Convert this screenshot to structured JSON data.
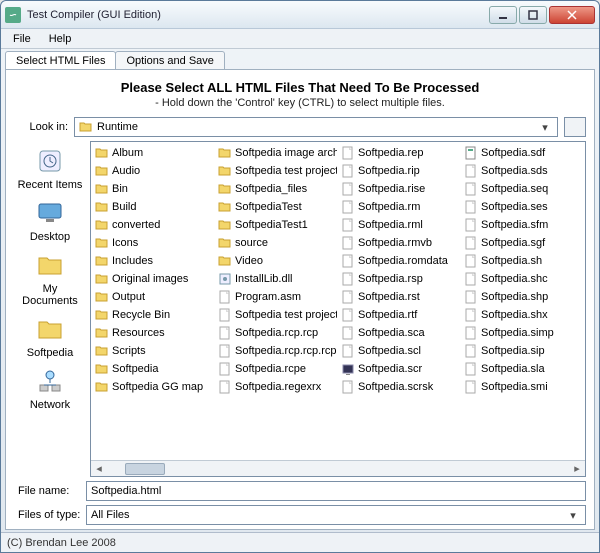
{
  "window": {
    "title": "Test Compiler (GUI Edition)"
  },
  "menu": {
    "file": "File",
    "help": "Help"
  },
  "tabs": {
    "select": "Select HTML Files",
    "options": "Options and Save"
  },
  "panel": {
    "heading": "Please Select ALL HTML Files That Need To Be Processed",
    "subheading": "- Hold down the 'Control' key (CTRL) to select multiple files.",
    "lookin_label": "Look in:",
    "lookin_value": "Runtime",
    "filename_label": "File name:",
    "filename_value": "Softpedia.html",
    "filetype_label": "Files of type:",
    "filetype_value": "All Files"
  },
  "places": [
    {
      "id": "recent",
      "label": "Recent Items"
    },
    {
      "id": "desktop",
      "label": "Desktop"
    },
    {
      "id": "mydocs",
      "label": "My Documents"
    },
    {
      "id": "softpedia",
      "label": "Softpedia"
    },
    {
      "id": "network",
      "label": "Network"
    }
  ],
  "files": [
    {
      "n": "Album",
      "t": "folder"
    },
    {
      "n": "Audio",
      "t": "folder"
    },
    {
      "n": "Bin",
      "t": "folder"
    },
    {
      "n": "Build",
      "t": "folder"
    },
    {
      "n": "converted",
      "t": "folder"
    },
    {
      "n": "Icons",
      "t": "folder"
    },
    {
      "n": "Includes",
      "t": "folder"
    },
    {
      "n": "Original images",
      "t": "folder"
    },
    {
      "n": "Output",
      "t": "folder"
    },
    {
      "n": "Recycle Bin",
      "t": "folder"
    },
    {
      "n": "Resources",
      "t": "folder"
    },
    {
      "n": "Scripts",
      "t": "folder"
    },
    {
      "n": "Softpedia",
      "t": "folder"
    },
    {
      "n": "Softpedia GG map",
      "t": "folder"
    },
    {
      "n": "Softpedia image archive",
      "t": "folder"
    },
    {
      "n": "Softpedia test project",
      "t": "folder"
    },
    {
      "n": "Softpedia_files",
      "t": "folder"
    },
    {
      "n": "SoftpediaTest",
      "t": "folder"
    },
    {
      "n": "SoftpediaTest1",
      "t": "folder"
    },
    {
      "n": "source",
      "t": "folder"
    },
    {
      "n": "Video",
      "t": "folder"
    },
    {
      "n": "InstallLib.dll",
      "t": "dll"
    },
    {
      "n": "Program.asm",
      "t": "file"
    },
    {
      "n": "Softpedia test project.lnp",
      "t": "file"
    },
    {
      "n": "Softpedia.rcp.rcp",
      "t": "file"
    },
    {
      "n": "Softpedia.rcp.rcp.rcp",
      "t": "file"
    },
    {
      "n": "Softpedia.rcpe",
      "t": "file"
    },
    {
      "n": "Softpedia.regexrx",
      "t": "file"
    },
    {
      "n": "Softpedia.rep",
      "t": "file"
    },
    {
      "n": "Softpedia.rip",
      "t": "file"
    },
    {
      "n": "Softpedia.rise",
      "t": "file"
    },
    {
      "n": "Softpedia.rm",
      "t": "file"
    },
    {
      "n": "Softpedia.rml",
      "t": "file"
    },
    {
      "n": "Softpedia.rmvb",
      "t": "file"
    },
    {
      "n": "Softpedia.romdata",
      "t": "file"
    },
    {
      "n": "Softpedia.rsp",
      "t": "file"
    },
    {
      "n": "Softpedia.rst",
      "t": "file"
    },
    {
      "n": "Softpedia.rtf",
      "t": "file"
    },
    {
      "n": "Softpedia.sca",
      "t": "file"
    },
    {
      "n": "Softpedia.scl",
      "t": "file"
    },
    {
      "n": "Softpedia.scr",
      "t": "scr"
    },
    {
      "n": "Softpedia.scrsk",
      "t": "file"
    },
    {
      "n": "Softpedia.sdf",
      "t": "sdf"
    },
    {
      "n": "Softpedia.sds",
      "t": "file"
    },
    {
      "n": "Softpedia.seq",
      "t": "file"
    },
    {
      "n": "Softpedia.ses",
      "t": "file"
    },
    {
      "n": "Softpedia.sfm",
      "t": "file"
    },
    {
      "n": "Softpedia.sgf",
      "t": "file"
    },
    {
      "n": "Softpedia.sh",
      "t": "file"
    },
    {
      "n": "Softpedia.shc",
      "t": "file"
    },
    {
      "n": "Softpedia.shp",
      "t": "file"
    },
    {
      "n": "Softpedia.shx",
      "t": "file"
    },
    {
      "n": "Softpedia.simp",
      "t": "file"
    },
    {
      "n": "Softpedia.sip",
      "t": "file"
    },
    {
      "n": "Softpedia.sla",
      "t": "file"
    },
    {
      "n": "Softpedia.smi",
      "t": "file"
    }
  ],
  "status": {
    "copyright": "(C) Brendan Lee 2008"
  }
}
